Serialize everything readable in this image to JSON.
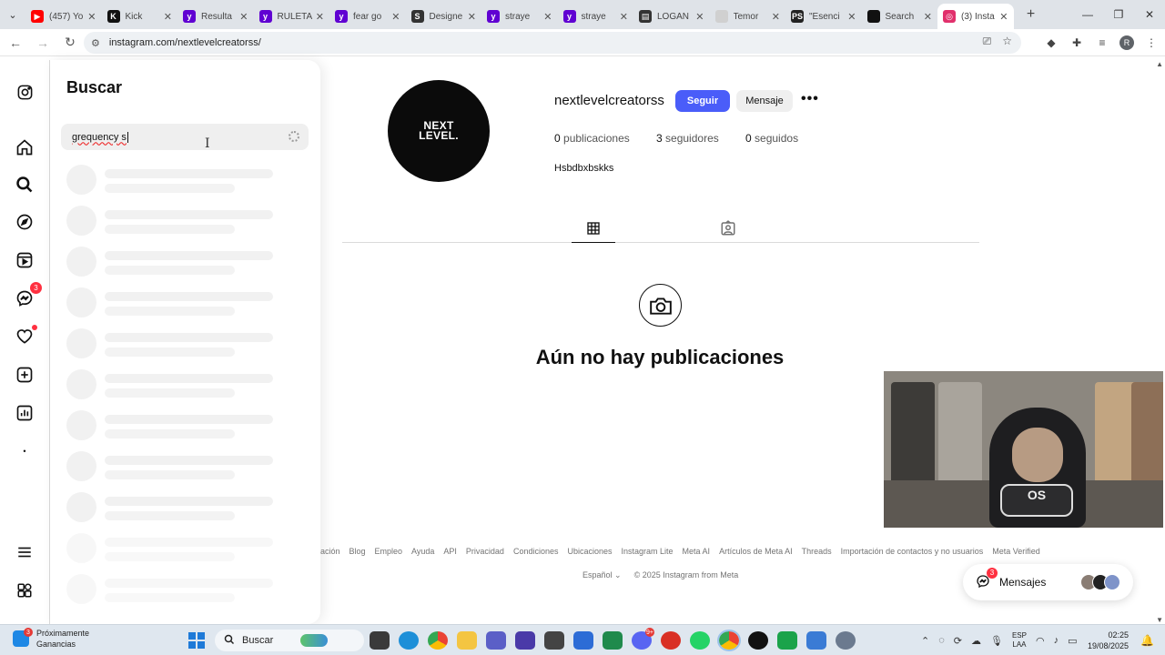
{
  "browser": {
    "tabs": [
      {
        "label": "(457) Yo",
        "color": "#ff0000",
        "icon": "youtube-icon",
        "glyph": "▶"
      },
      {
        "label": "Kick",
        "color": "#111111",
        "icon": "kick-icon",
        "glyph": "K"
      },
      {
        "label": "Resulta",
        "color": "#6001d2",
        "icon": "yahoo-icon",
        "glyph": "y"
      },
      {
        "label": "RULETA",
        "color": "#6001d2",
        "icon": "yahoo-icon",
        "glyph": "y"
      },
      {
        "label": "fear go",
        "color": "#6001d2",
        "icon": "yahoo-icon",
        "glyph": "y"
      },
      {
        "label": "Designe",
        "color": "#333333",
        "icon": "s-site-icon",
        "glyph": "S"
      },
      {
        "label": "straye",
        "color": "#6001d2",
        "icon": "yahoo-icon",
        "glyph": "y"
      },
      {
        "label": "straye",
        "color": "#6001d2",
        "icon": "yahoo-icon",
        "glyph": "y"
      },
      {
        "label": "LOGAN",
        "color": "#333333",
        "icon": "logan-icon",
        "glyph": "▤"
      },
      {
        "label": "Temor",
        "color": "#d0d0d0",
        "icon": "blank-page-icon",
        "glyph": ""
      },
      {
        "label": "\"Esenci",
        "color": "#222222",
        "icon": "ps-icon",
        "glyph": "PS"
      },
      {
        "label": "Search",
        "color": "#111111",
        "icon": "search-site-icon",
        "glyph": ""
      },
      {
        "label": "(3) Insta",
        "color": "#e1306c",
        "icon": "instagram-icon",
        "glyph": "◎",
        "active": true
      }
    ],
    "url": "instagram.com/nextlevelcreatorss/"
  },
  "nav": {
    "badge_notifications": "3"
  },
  "search": {
    "title": "Buscar",
    "value": "grequency s",
    "skeleton_rows": 11
  },
  "profile": {
    "avatar_text_line1": "NEXT",
    "avatar_text_line2": "LEVEL.",
    "username": "nextlevelcreatorss",
    "follow_label": "Seguir",
    "message_label": "Mensaje",
    "more_label": "•••",
    "posts_count": "0",
    "posts_label": "publicaciones",
    "followers_count": "3",
    "followers_label": "seguidores",
    "following_count": "0",
    "following_label": "seguidos",
    "bio": "Hsbdbxbskks",
    "empty_title": "Aún no hay publicaciones"
  },
  "webcam": {
    "shirt_text": "OS"
  },
  "footer": {
    "links": [
      "ación",
      "Blog",
      "Empleo",
      "Ayuda",
      "API",
      "Privacidad",
      "Condiciones",
      "Ubicaciones",
      "Instagram Lite",
      "Meta AI",
      "Artículos de Meta AI",
      "Threads",
      "Importación de contactos y no usuarios",
      "Meta Verified"
    ],
    "language": "Español",
    "copyright": "© 2025 Instagram from Meta"
  },
  "messages": {
    "label": "Mensajes",
    "badge": "3"
  },
  "taskbar": {
    "weather_title": "Próximamente",
    "weather_subtitle": "Ganancias",
    "weather_badge": "3",
    "search_placeholder": "Buscar",
    "lang_line1": "ESP",
    "lang_line2": "LAA",
    "time": "02:25",
    "date": "19/08/2025",
    "messenger_badge": "9+"
  }
}
